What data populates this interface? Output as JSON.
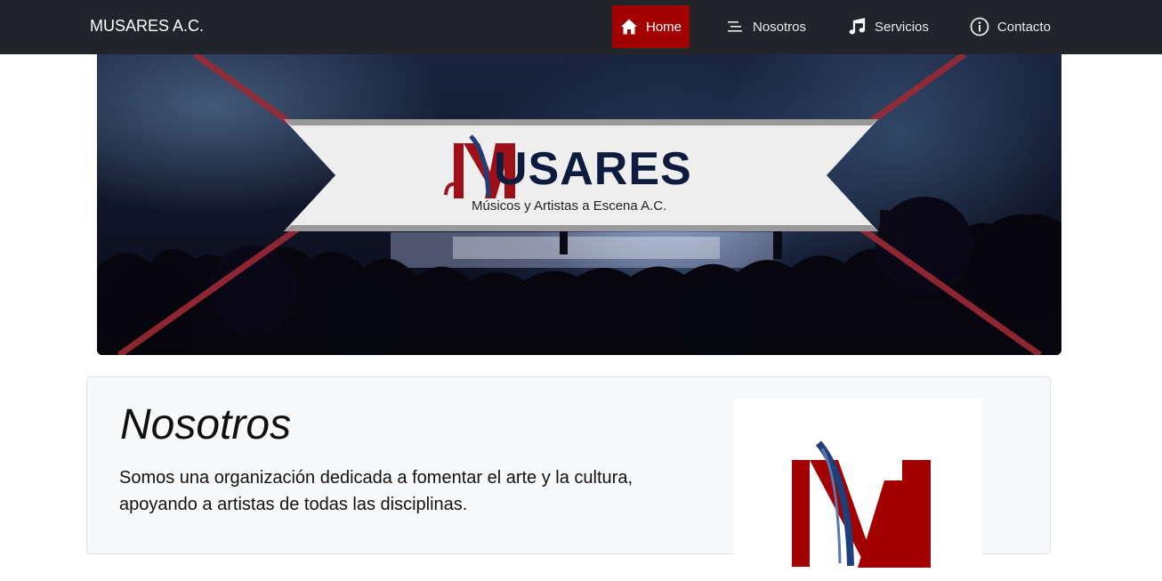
{
  "navbar": {
    "brand": "MUSARES A.C.",
    "items": [
      {
        "label": "Home",
        "icon": "home-icon",
        "active": true
      },
      {
        "label": "Nosotros",
        "icon": "menu-lines-icon",
        "active": false
      },
      {
        "label": "Servicios",
        "icon": "music-note-icon",
        "active": false
      },
      {
        "label": "Contacto",
        "icon": "info-icon",
        "active": false
      }
    ]
  },
  "hero": {
    "logo_word": "USARES",
    "logo_subtitle": "Músicos y Artistas a Escena A.C."
  },
  "about": {
    "title": "Nosotros",
    "text": "Somos una organización dedicada a fomentar el arte y la cultura, apoyando a artistas de todas las disciplinas."
  },
  "colors": {
    "navbar_bg": "#212529",
    "active_bg": "#a30000",
    "brand_red": "#a30000",
    "brand_navy": "#0d1b3e",
    "card_bg": "#f8f9fa"
  }
}
